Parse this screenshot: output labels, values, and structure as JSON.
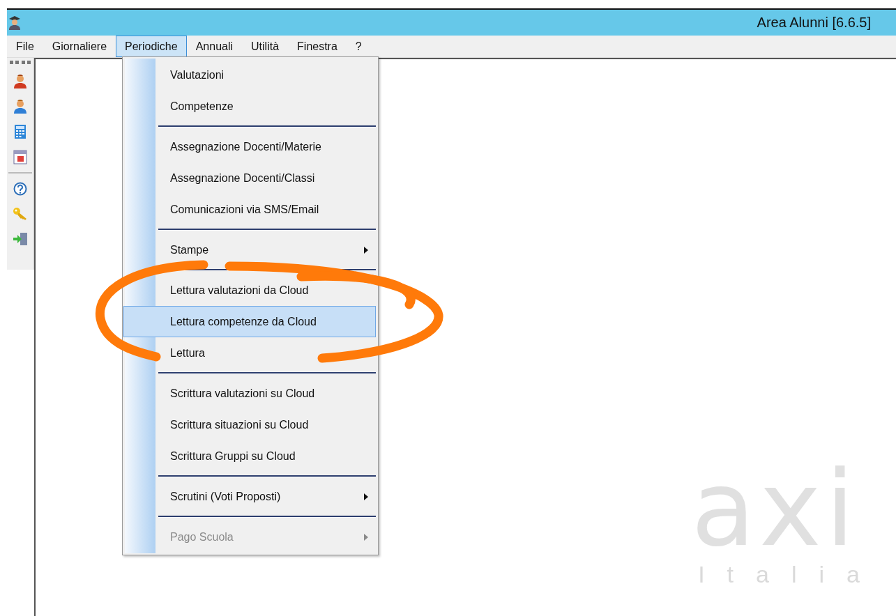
{
  "window": {
    "title": "Area Alunni [6.6.5]"
  },
  "menu_bar": [
    {
      "label": "File",
      "selected": false
    },
    {
      "label": "Giornaliere",
      "selected": false
    },
    {
      "label": "Periodiche",
      "selected": true
    },
    {
      "label": "Annuali",
      "selected": false
    },
    {
      "label": "Utilità",
      "selected": false
    },
    {
      "label": "Finestra",
      "selected": false
    },
    {
      "label": "?",
      "selected": false
    }
  ],
  "dropdown": [
    {
      "kind": "item",
      "label": "Valutazioni",
      "selected": false,
      "disabled": false,
      "submenu": false
    },
    {
      "kind": "item",
      "label": "Competenze",
      "selected": false,
      "disabled": false,
      "submenu": false
    },
    {
      "kind": "separator"
    },
    {
      "kind": "item",
      "label": "Assegnazione Docenti/Materie",
      "selected": false,
      "disabled": false,
      "submenu": false
    },
    {
      "kind": "item",
      "label": "Assegnazione Docenti/Classi",
      "selected": false,
      "disabled": false,
      "submenu": false
    },
    {
      "kind": "item",
      "label": "Comunicazioni via SMS/Email",
      "selected": false,
      "disabled": false,
      "submenu": false
    },
    {
      "kind": "separator"
    },
    {
      "kind": "item",
      "label": "Stampe",
      "selected": false,
      "disabled": false,
      "submenu": true
    },
    {
      "kind": "separator"
    },
    {
      "kind": "item",
      "label": "Lettura valutazioni da Cloud",
      "selected": false,
      "disabled": false,
      "submenu": false
    },
    {
      "kind": "item",
      "label": "Lettura competenze da Cloud",
      "selected": true,
      "disabled": false,
      "submenu": false
    },
    {
      "kind": "item",
      "label": "Lettura",
      "selected": false,
      "disabled": false,
      "submenu": false
    },
    {
      "kind": "separator"
    },
    {
      "kind": "item",
      "label": "Scrittura valutazioni su Cloud",
      "selected": false,
      "disabled": false,
      "submenu": false
    },
    {
      "kind": "item",
      "label": "Scrittura situazioni su Cloud",
      "selected": false,
      "disabled": false,
      "submenu": false
    },
    {
      "kind": "item",
      "label": "Scrittura Gruppi su Cloud",
      "selected": false,
      "disabled": false,
      "submenu": false
    },
    {
      "kind": "separator"
    },
    {
      "kind": "item",
      "label": "Scrutini (Voti Proposti)",
      "selected": false,
      "disabled": false,
      "submenu": true
    },
    {
      "kind": "separator"
    },
    {
      "kind": "item",
      "label": "Pago Scuola",
      "selected": false,
      "disabled": true,
      "submenu": true
    }
  ],
  "toolbar": [
    {
      "kind": "grip"
    },
    {
      "kind": "user-red"
    },
    {
      "kind": "user-blue"
    },
    {
      "kind": "calculator"
    },
    {
      "kind": "calendar"
    },
    {
      "kind": "separator"
    },
    {
      "kind": "help"
    },
    {
      "kind": "key"
    },
    {
      "kind": "exit"
    }
  ],
  "logo": {
    "wordmark": "axi",
    "tagline": "Italia"
  }
}
